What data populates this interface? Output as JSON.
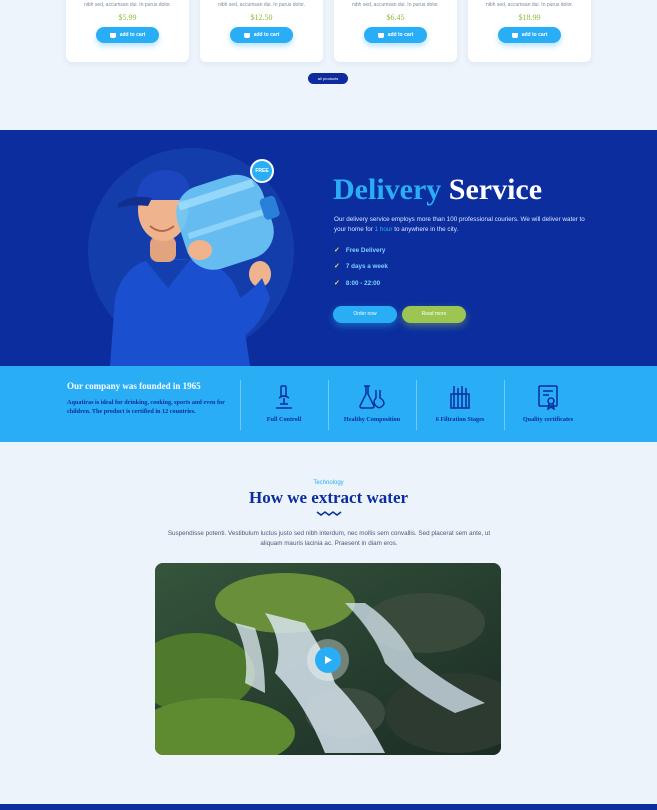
{
  "products": [
    {
      "desc": "nibh sed, accumsan dui. In purus dolor.",
      "price": "$5.99",
      "button": "add to cart"
    },
    {
      "desc": "nibh sed, accumsan dui. In purus dolor.",
      "price": "$12.50",
      "button": "add to cart"
    },
    {
      "desc": "nibh sed, accumsan dui. In purus dolor.",
      "price": "$6.45",
      "button": "add to cart"
    },
    {
      "desc": "nibh sed, accumsan dui. In purus dolor.",
      "price": "$18.99",
      "button": "add to cart"
    }
  ],
  "all_products_label": "all products",
  "delivery": {
    "badge": "FREE",
    "title_accent": "Delivery",
    "title_rest": " Service",
    "text_before": "Our delivery service employs more than 100 professional couriers. We will deliver water to your home for ",
    "text_highlight": "1 hour",
    "text_after": " to anywhere in the city.",
    "features": [
      "Free Delivery",
      "7 days a week",
      "8:00 - 22:00"
    ],
    "order_label": "Order now",
    "read_label": "Read more"
  },
  "band": {
    "title": "Our company was founded in 1965",
    "text": "Aquatiras is ideal for drinking, cooking, sports and even for children. The product is certified in 12 countries.",
    "items": [
      {
        "label": "Full Controll",
        "icon": "microscope-icon"
      },
      {
        "label": "Healthy Composition",
        "icon": "flask-icon"
      },
      {
        "label": "6 Filtration Stages",
        "icon": "filter-icon"
      },
      {
        "label": "Quality certificates",
        "icon": "certificate-icon"
      }
    ]
  },
  "technology": {
    "eyebrow": "Technology",
    "title": "How we extract water",
    "intro": "Suspendisse potenti. Vestibulum luctus justo sed nibh interdum, nec mollis sem convallis. Sed placerat sem ante, ut aliquam mauris lacinia ac. Praesent in diam eros."
  },
  "colors": {
    "navy": "#0b2d9e",
    "sky": "#29aef5",
    "green": "#9cc551",
    "bg": "#eef4fb"
  }
}
